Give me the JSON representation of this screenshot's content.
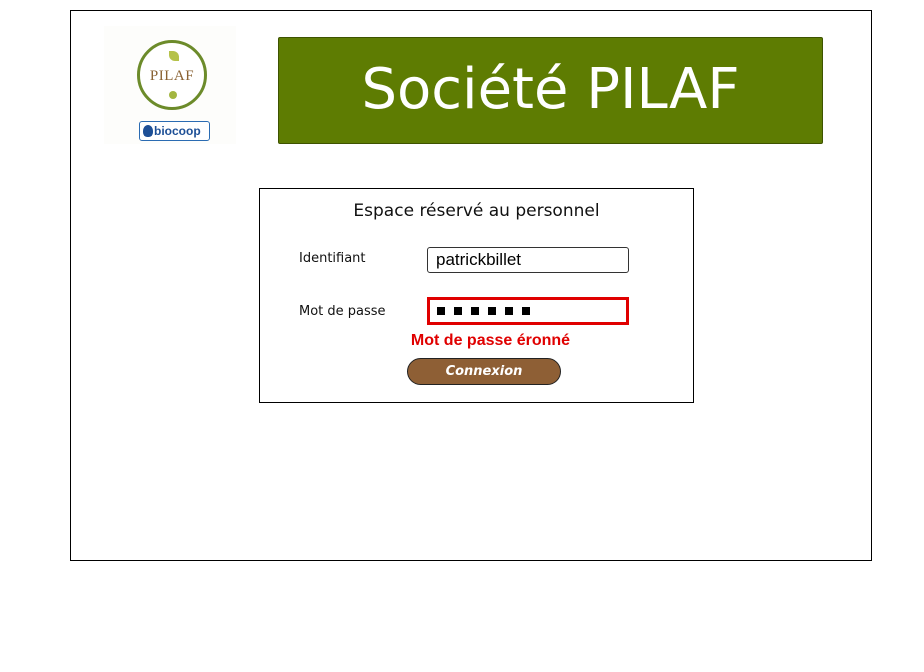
{
  "header": {
    "logo_text": "PILAF",
    "badge_text": "biocoop",
    "title": "Société PILAF"
  },
  "login": {
    "title": "Espace réservé au personnel",
    "identifiant_label": "Identifiant",
    "identifiant_value": "patrickbillet",
    "password_label": "Mot de passe",
    "password_masked_length": 6,
    "error_message": "Mot de passe éronné",
    "submit_label": "Connexion"
  },
  "colors": {
    "banner": "#5e7c02",
    "error": "#e00000",
    "button": "#8e5f35"
  },
  "icons": {
    "logo": "pilaf-leaf-logo",
    "badge": "biocoop-badge"
  }
}
